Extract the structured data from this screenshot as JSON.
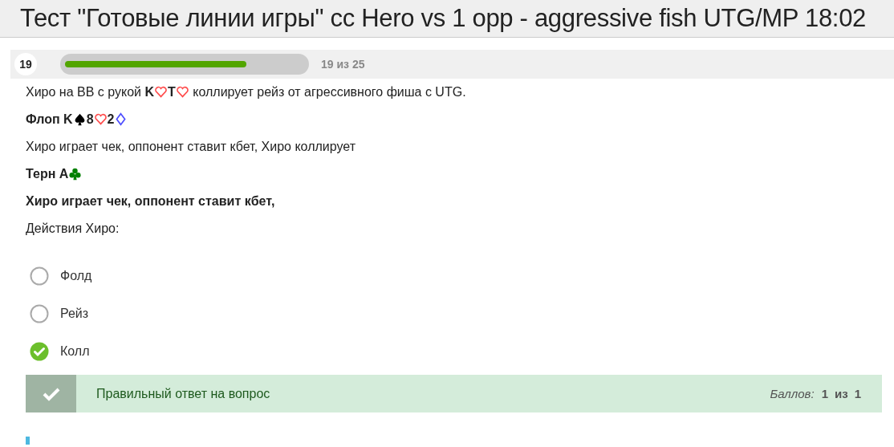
{
  "window": {
    "title": "Тест \"Готовые линии игры\" cc Hero vs 1 opp - aggressive fish UTG/MP 18:02"
  },
  "question": {
    "number": "19",
    "progress": {
      "level": 0.76,
      "label": "19 из 25"
    },
    "lines": [
      {
        "parts": [
          {
            "kind": "text",
            "text": "Хиро на BB с рукой ",
            "bold": false
          },
          {
            "kind": "text",
            "text": "K",
            "bold": true
          },
          {
            "kind": "heart",
            "color": "#ff4d4d"
          },
          {
            "kind": "text",
            "text": "T",
            "bold": true
          },
          {
            "kind": "heart",
            "color": "#ff4d4d"
          },
          {
            "kind": "text",
            "text": " коллирует рейз от агрессивного фиша с UTG.",
            "bold": false
          }
        ]
      },
      {
        "parts": [
          {
            "kind": "text",
            "text": "Флоп K",
            "bold": true
          },
          {
            "kind": "spade",
            "color": "#000000"
          },
          {
            "kind": "text",
            "text": "8",
            "bold": true
          },
          {
            "kind": "heart",
            "color": "#ff4d4d"
          },
          {
            "kind": "text",
            "text": "2",
            "bold": true
          },
          {
            "kind": "diamond",
            "color": "#4d4dff"
          }
        ]
      },
      {
        "parts": [
          {
            "kind": "text",
            "text": "Хиро играет чек, оппонент ставит кбет, Хиро коллирует",
            "bold": false
          }
        ]
      },
      {
        "parts": [
          {
            "kind": "text",
            "text": "Терн A",
            "bold": true
          },
          {
            "kind": "club",
            "color": "#008000"
          }
        ]
      },
      {
        "parts": [
          {
            "kind": "text",
            "text": "Хиро играет чек, оппонент ставит кбет,",
            "bold": true
          }
        ]
      },
      {
        "parts": [
          {
            "kind": "text",
            "text": "Действия Хиро:",
            "bold": false
          }
        ]
      }
    ],
    "options": [
      {
        "label": "Фолд",
        "selected": false
      },
      {
        "label": "Рейз",
        "selected": false
      },
      {
        "label": "Колл",
        "selected": true
      }
    ],
    "feedback": {
      "message": "Правильный ответ на вопрос",
      "score_label": "Баллов:",
      "score": "1",
      "of": "из",
      "max": "1"
    }
  }
}
